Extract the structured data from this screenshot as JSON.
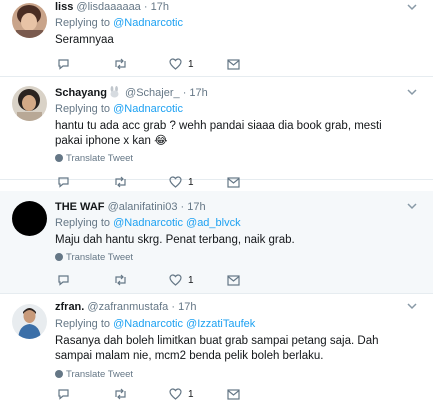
{
  "tweets": [
    {
      "name": "liss",
      "handle": "@lisdaaaaaa",
      "time": "17h",
      "reply_prefix": "Replying to",
      "reply_mentions": "@Nadnarcotic",
      "text": "Seramnyaa",
      "likes": "1",
      "translate": ""
    },
    {
      "name": "Schayang",
      "handle": "@Schajer_",
      "time": "17h",
      "reply_prefix": "Replying to",
      "reply_mentions": "@Nadnarcotic",
      "text": "hantu tu ada acc grab ? wehh pandai siaaa dia book grab, mesti pakai iphone  x kan 😂",
      "likes": "1",
      "translate": "Translate Tweet"
    },
    {
      "name": "THE WAF",
      "handle": "@alanifatini03",
      "time": "17h",
      "reply_prefix": "Replying to",
      "reply_mentions": "@Nadnarcotic @ad_blvck",
      "text": "Maju dah hantu skrg. Penat terbang, naik grab.",
      "likes": "1",
      "translate": "Translate Tweet"
    },
    {
      "name": "zfran.",
      "handle": "@zafranmustafa",
      "time": "17h",
      "reply_prefix": "Replying to",
      "reply_mentions": "@Nadnarcotic @IzzatiTaufek",
      "text": "Rasanya dah boleh limitkan buat grab sampai petang saja. Dah sampai malam nie, mcm2 benda pelik boleh berlaku.",
      "likes": "1",
      "translate": "Translate Tweet"
    }
  ],
  "separator": "·",
  "icons": {
    "caret": "chevron-down-icon",
    "reply": "reply-icon",
    "retweet": "retweet-icon",
    "like": "heart-icon",
    "dm": "envelope-icon",
    "translate": "globe-icon"
  },
  "colors": {
    "link": "#1da1f2",
    "muted": "#657786",
    "border": "#e6ecf0",
    "highlight_bg": "#f5f8fa"
  }
}
